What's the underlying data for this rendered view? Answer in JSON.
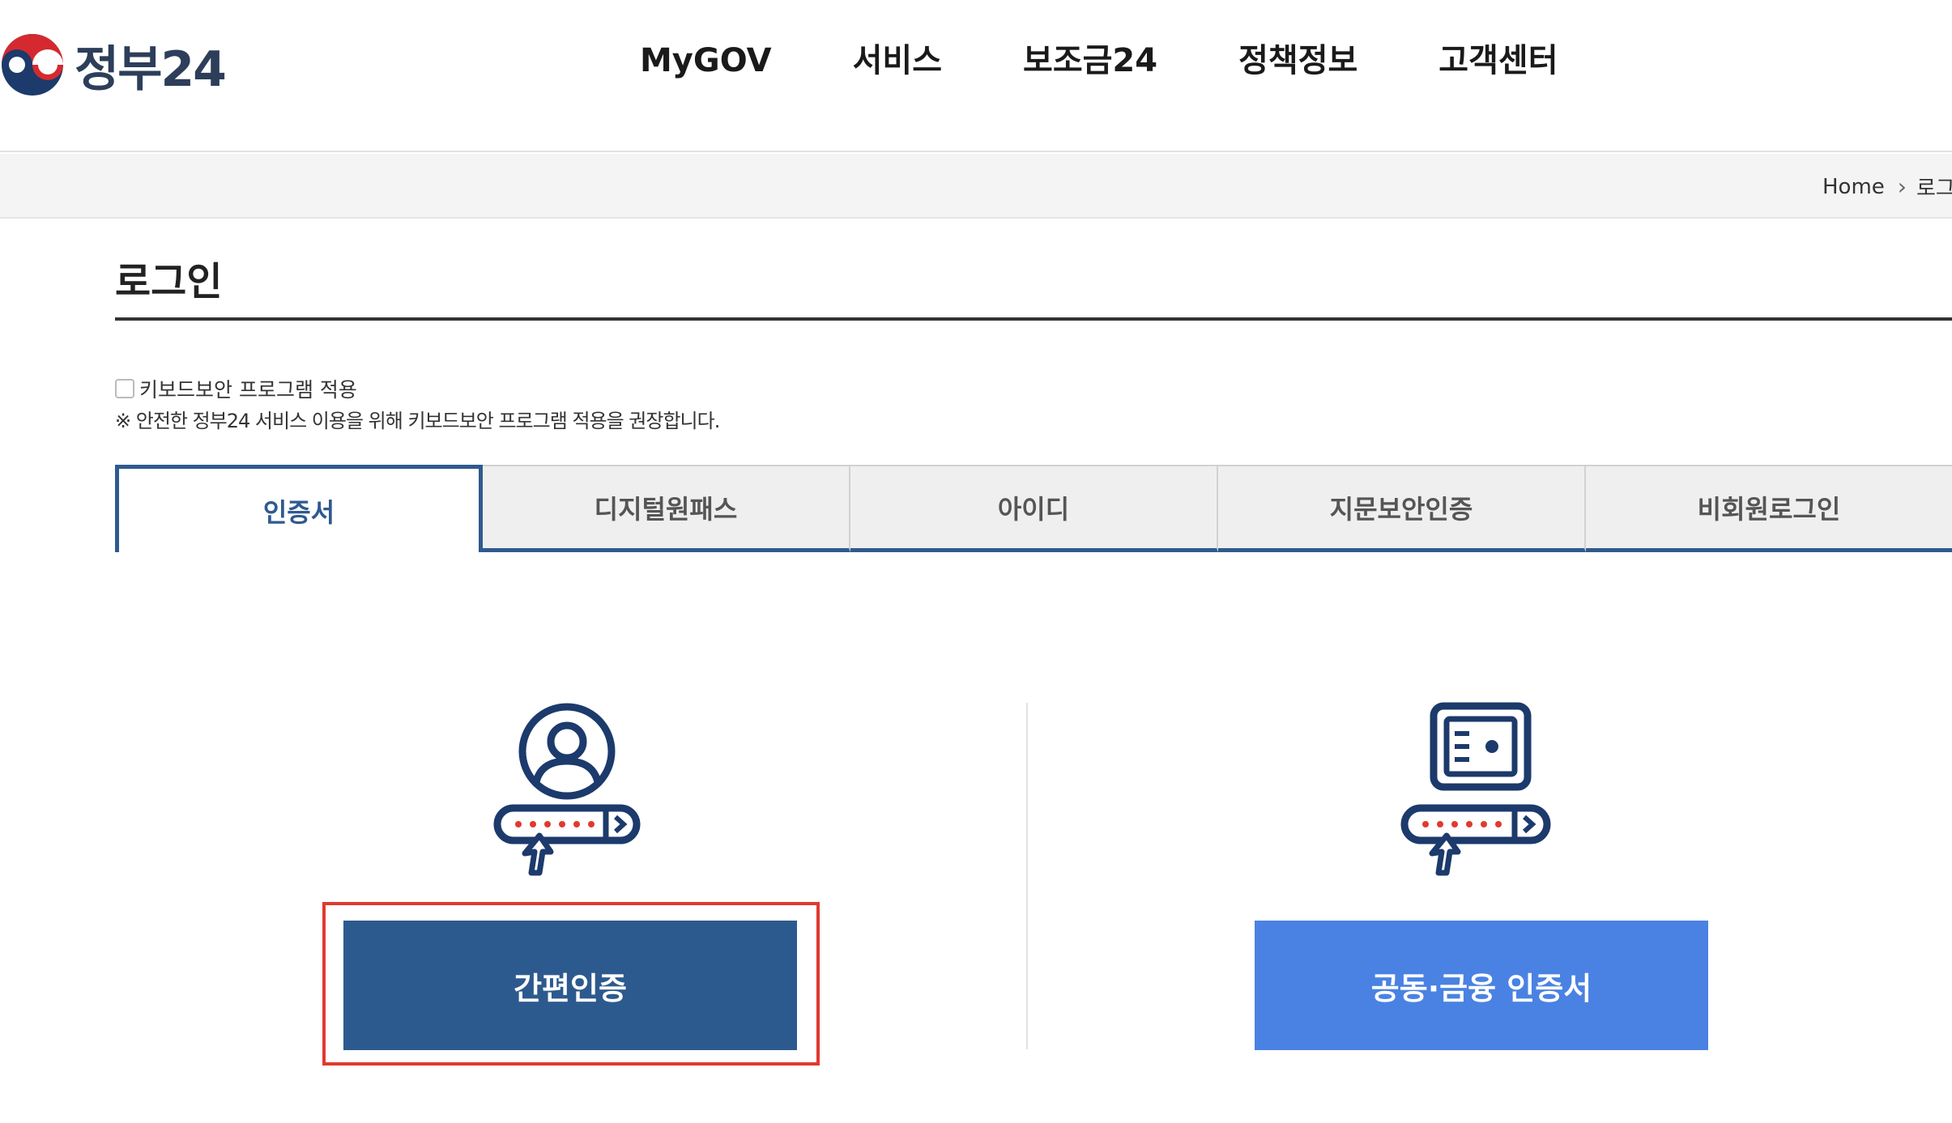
{
  "header": {
    "logo_text": "정부24",
    "nav": [
      "MyGOV",
      "서비스",
      "보조금24",
      "정책정보",
      "고객센터"
    ]
  },
  "breadcrumb": {
    "home": "Home",
    "current": "로그인"
  },
  "page": {
    "title": "로그인"
  },
  "keyboard_security": {
    "label": "키보드보안 프로그램 적용",
    "checked": false,
    "note": "※ 안전한 정부24 서비스 이용을 위해 키보드보안 프로그램 적용을 권장합니다."
  },
  "tabs": [
    {
      "label": "인증서",
      "active": true
    },
    {
      "label": "디지털원패스",
      "active": false
    },
    {
      "label": "아이디",
      "active": false
    },
    {
      "label": "지문보안인증",
      "active": false
    },
    {
      "label": "비회원로그인",
      "active": false
    }
  ],
  "options": {
    "simple_auth": {
      "label": "간편인증",
      "icon": "user-password-icon"
    },
    "joint_cert": {
      "label": "공동·금융 인증서",
      "icon": "safe-password-icon"
    }
  },
  "colors": {
    "primary": "#2d5a8e",
    "secondary_button": "#4a82e3",
    "highlight": "#e03a2e",
    "password_dots": "#e03a2e"
  }
}
